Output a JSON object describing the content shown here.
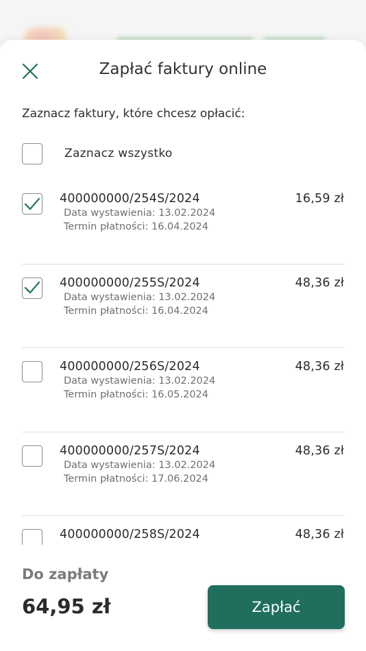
{
  "colors": {
    "accent": "#1f6e5e",
    "check": "#2a7a63"
  },
  "header": {
    "title": "Zapłać faktury online",
    "close_icon": "close-icon"
  },
  "subtitle": "Zaznacz faktury, które chcesz opłacić:",
  "select_all": {
    "label": "Zaznacz wszystko",
    "checked": false
  },
  "invoices": [
    {
      "number": "400000000/254S/2024",
      "amount": "16,59 zł",
      "issued": "Data wystawienia: 13.02.2024",
      "due": "Termin płatności: 16.04.2024",
      "checked": true
    },
    {
      "number": "400000000/255S/2024",
      "amount": "48,36 zł",
      "issued": "Data wystawienia: 13.02.2024",
      "due": "Termin płatności: 16.04.2024",
      "checked": true
    },
    {
      "number": "400000000/256S/2024",
      "amount": "48,36 zł",
      "issued": "Data wystawienia: 13.02.2024",
      "due": "Termin płatności: 16.05.2024",
      "checked": false
    },
    {
      "number": "400000000/257S/2024",
      "amount": "48,36 zł",
      "issued": "Data wystawienia: 13.02.2024",
      "due": "Termin płatności: 17.06.2024",
      "checked": false
    },
    {
      "number": "400000000/258S/2024",
      "amount": "48,36 zł",
      "issued": "",
      "due": "",
      "checked": false
    }
  ],
  "footer": {
    "to_pay_label": "Do zapłaty",
    "to_pay_amount": "64,95 zł",
    "pay_button": "Zapłać"
  }
}
